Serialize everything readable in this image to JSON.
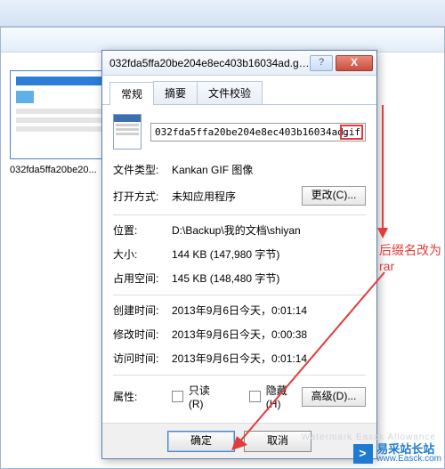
{
  "explorer": {
    "thumb_filename": "032fda5ffa20be20..."
  },
  "dialog": {
    "title": "032fda5ffa20be204e8ec403b16034ad.gif...",
    "help": "?",
    "close": "X",
    "tabs": {
      "general": "常规",
      "summary": "摘要",
      "checksum": "文件校验"
    },
    "filename_base": "032fda5ffa20be204e8ec403b16034ad.",
    "filename_ext": "gif",
    "labels": {
      "filetype": "文件类型:",
      "opens_with": "打开方式:",
      "location": "位置:",
      "size": "大小:",
      "size_on_disk": "占用空间:",
      "created": "创建时间:",
      "modified": "修改时间:",
      "accessed": "访问时间:",
      "attributes": "属性:"
    },
    "values": {
      "filetype": "Kankan GIF 图像",
      "opens_with": "未知应用程序",
      "location": "D:\\Backup\\我的文档\\shiyan",
      "size": "144 KB (147,980 字节)",
      "size_on_disk": "145 KB (148,480 字节)",
      "created": "2013年9月6日今天，0:01:14",
      "modified": "2013年9月6日今天，0:00:38",
      "accessed": "2013年9月6日今天，0:01:14"
    },
    "buttons": {
      "change": "更改(C)...",
      "advanced": "高级(D)...",
      "ok": "确定",
      "cancel": "取消"
    },
    "checkboxes": {
      "readonly": "只读(R)",
      "hidden": "隐藏(H)"
    }
  },
  "annotation": {
    "line1": "后缀名改为",
    "line2": "rar"
  },
  "watermark": {
    "brand_cn": "易采站长站",
    "brand_en": "www.Easck.com",
    "faint": "Watermark Easck Allowance"
  }
}
